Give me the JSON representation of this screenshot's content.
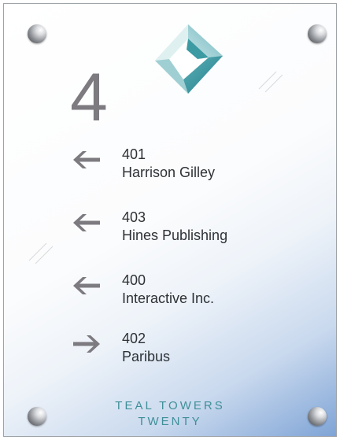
{
  "sign": {
    "floor_number": "4",
    "building_name_line1": "TEAL TOWERS",
    "building_name_line2": "TWENTY",
    "logo_icon": "teal-diamond-logo-icon",
    "colors": {
      "building_name": "#3f8f98",
      "floor_number": "#7d7a80",
      "arrows": "#7d7a80",
      "text": "#2e3236",
      "gradient_corner": "#7fa4d6"
    }
  },
  "directory": [
    {
      "suite": "401",
      "tenant": "Harrison Gilley",
      "direction": "left",
      "icon": "arrow-left-icon"
    },
    {
      "suite": "403",
      "tenant": "Hines Publishing",
      "direction": "left",
      "icon": "arrow-left-icon"
    },
    {
      "suite": "400",
      "tenant": "Interactive Inc.",
      "direction": "left",
      "icon": "arrow-left-icon"
    },
    {
      "suite": "402",
      "tenant": "Paribus",
      "direction": "right",
      "icon": "arrow-right-icon"
    }
  ]
}
